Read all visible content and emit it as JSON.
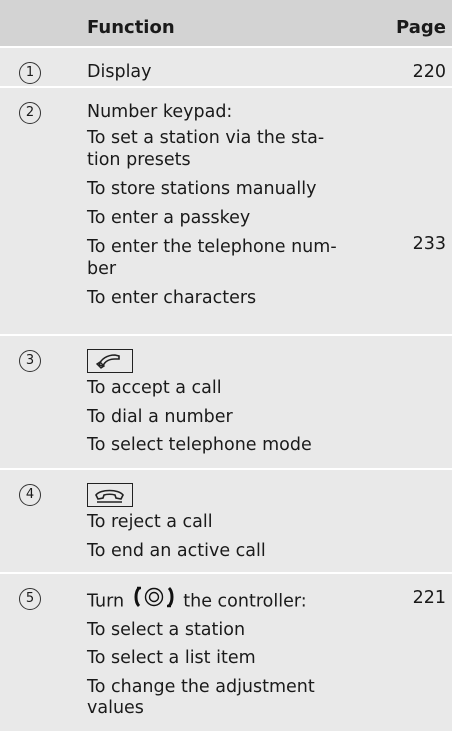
{
  "header": {
    "function": "Function",
    "page": "Page"
  },
  "rows": [
    {
      "num": "1",
      "lines": [
        "Display"
      ],
      "page": "220"
    },
    {
      "num": "2",
      "lines": [
        "Number keypad:",
        "To set a station via the sta-",
        "tion presets",
        "To store stations manually",
        "To enter a passkey",
        "To enter the telephone num-",
        "ber",
        "To enter characters"
      ],
      "page": "233"
    },
    {
      "num": "3",
      "key_icon": "call-accept-key-icon",
      "lines": [
        "To accept a call",
        "To dial a number",
        "To select telephone mode"
      ],
      "page": ""
    },
    {
      "num": "4",
      "key_icon": "call-end-key-icon",
      "lines": [
        "To reject a call",
        "To end an active call"
      ],
      "page": ""
    },
    {
      "num": "5",
      "first_line_pre": "Turn",
      "controller_icon": "controller-turn-icon",
      "first_line_post": "the controller:",
      "lines": [
        "To select a station",
        "To select a list item",
        "To change the adjustment",
        "values"
      ],
      "page": "221"
    }
  ]
}
